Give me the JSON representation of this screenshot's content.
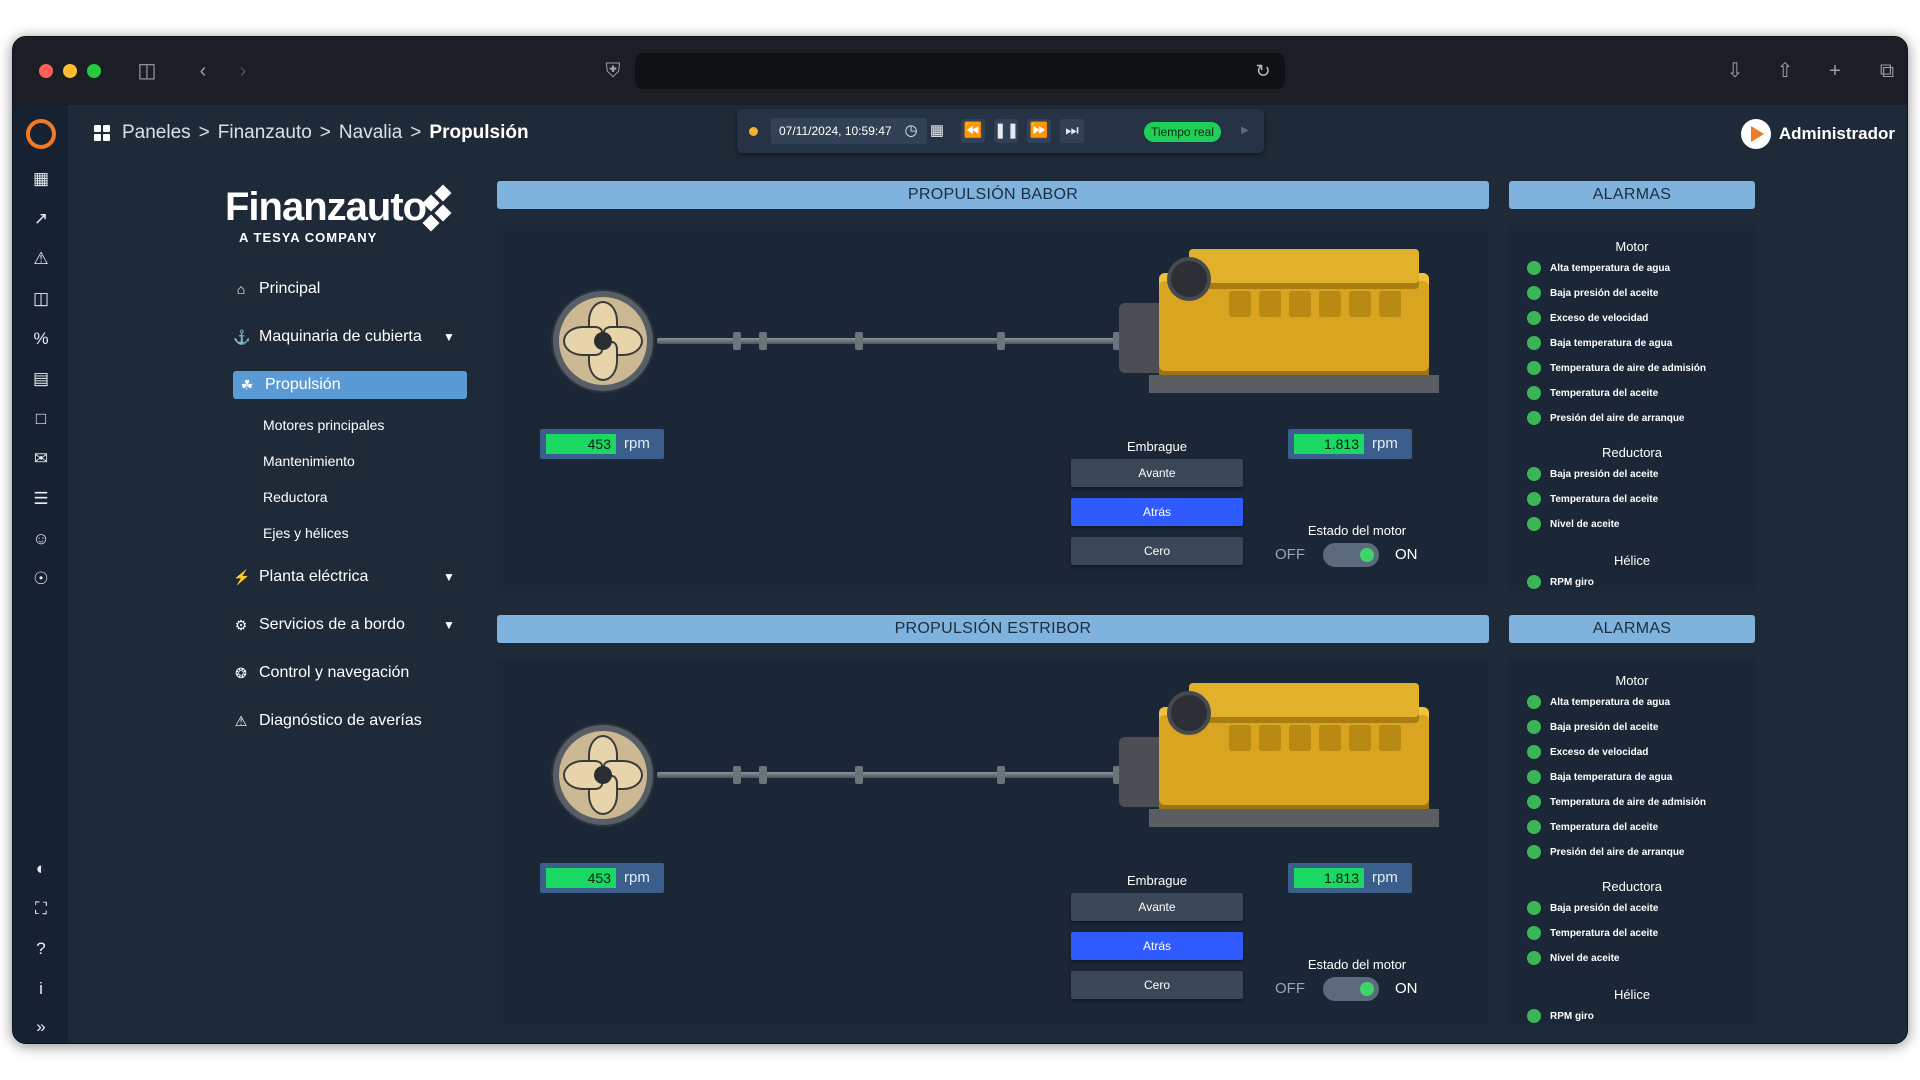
{
  "breadcrumbs": [
    "Paneles",
    "Finanzauto",
    "Navalia",
    "Propulsión"
  ],
  "player": {
    "datetime": "07/11/2024, 10:59:47",
    "live_label": "Tiempo real"
  },
  "user": {
    "name": "Administrador"
  },
  "brand": {
    "name": "Finanzauto",
    "tagline": "A TESYA COMPANY"
  },
  "menu": {
    "items": [
      {
        "label": "Principal",
        "icon": "home-icon"
      },
      {
        "label": "Maquinaria de cubierta",
        "icon": "ship-icon"
      },
      {
        "label": "Propulsión",
        "icon": "propeller-icon"
      },
      {
        "label": "Planta eléctrica",
        "icon": "bolt-icon"
      },
      {
        "label": "Servicios de a bordo",
        "icon": "services-icon"
      },
      {
        "label": "Control y navegación",
        "icon": "helm-icon"
      },
      {
        "label": "Diagnóstico de averías",
        "icon": "warning-icon"
      }
    ],
    "propulsion_sub": [
      "Motores principales",
      "Mantenimiento",
      "Reductora",
      "Ejes y hélices"
    ]
  },
  "panels": [
    {
      "title": "PROPULSIÓN BABOR",
      "alarms_title": "ALARMAS",
      "shaft_rpm": "453",
      "engine_rpm": "1.813",
      "rpm_unit": "rpm",
      "clutch_label": "Embrague",
      "clutch_buttons": [
        "Avante",
        "Atrás",
        "Cero"
      ],
      "clutch_selected": "Atrás",
      "engine_state_label": "Estado del motor",
      "off_label": "OFF",
      "on_label": "ON",
      "engine_on": true
    },
    {
      "title": "PROPULSIÓN ESTRIBOR",
      "alarms_title": "ALARMAS",
      "shaft_rpm": "453",
      "engine_rpm": "1.813",
      "rpm_unit": "rpm",
      "clutch_label": "Embrague",
      "clutch_buttons": [
        "Avante",
        "Atrás",
        "Cero"
      ],
      "clutch_selected": "Atrás",
      "engine_state_label": "Estado del motor",
      "off_label": "OFF",
      "on_label": "ON",
      "engine_on": true
    }
  ],
  "alarms": {
    "motor_title": "Motor",
    "motor": [
      "Alta temperatura de agua",
      "Baja presión del aceite",
      "Exceso de velocidad",
      "Baja temperatura de agua",
      "Temperatura de aire de admisión",
      "Temperatura del aceite",
      "Presión del aire de arranque"
    ],
    "reductora_title": "Reductora",
    "reductora": [
      "Baja presión del aceite",
      "Temperatura del aceite",
      "Nivel de aceite"
    ],
    "helice_title": "Hélice",
    "helice": [
      "RPM giro"
    ],
    "status_color": "#3ab656"
  },
  "colors": {
    "accent": "#5b9bd5",
    "header": "#7fb2dc",
    "selected_button": "#2f5bff",
    "rpm_value": "#1bd862",
    "brand_orange": "#f07b23"
  }
}
